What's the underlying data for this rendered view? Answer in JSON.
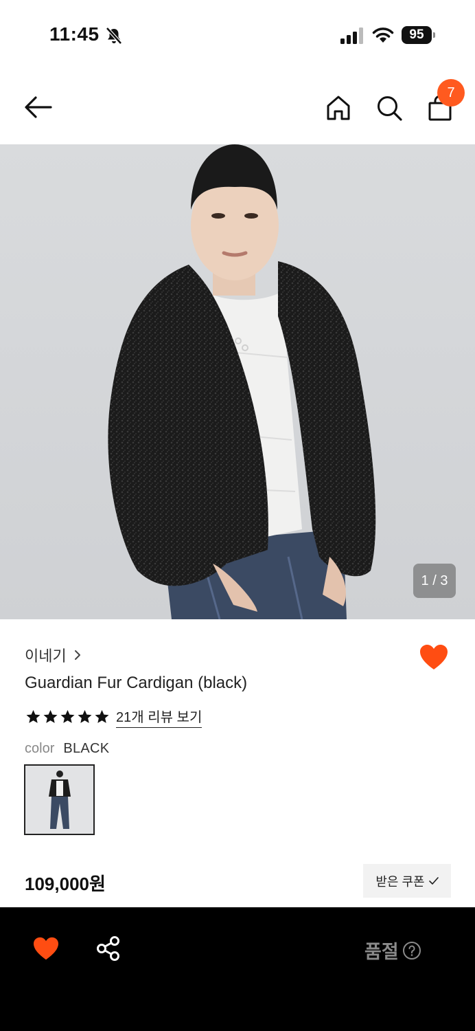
{
  "status_bar": {
    "time": "11:45",
    "battery": "95",
    "icons": [
      "bell-off-icon",
      "cellular-signal-icon",
      "wifi-icon",
      "battery-icon"
    ]
  },
  "nav": {
    "cart_count": "7",
    "icons": [
      "back-arrow-icon",
      "home-icon",
      "search-icon",
      "shopping-bag-icon"
    ]
  },
  "hero": {
    "page_indicator": "1 / 3"
  },
  "product": {
    "brand": "이네기",
    "title": "Guardian Fur Cardigan (black)",
    "rating_stars": 5,
    "review_link": "21개 리뷰 보기",
    "color_label": "color",
    "color_value": "BLACK",
    "price": "109,000원",
    "coupon_label": "받은 쿠폰",
    "wishlisted": true
  },
  "bottom_bar": {
    "status_label": "품절",
    "icons": [
      "heart-icon",
      "share-icon",
      "help-icon"
    ]
  },
  "colors": {
    "accent": "#ff5a1f",
    "bottom_bar": "#000000",
    "sold_out_text": "#8a8a8a"
  }
}
